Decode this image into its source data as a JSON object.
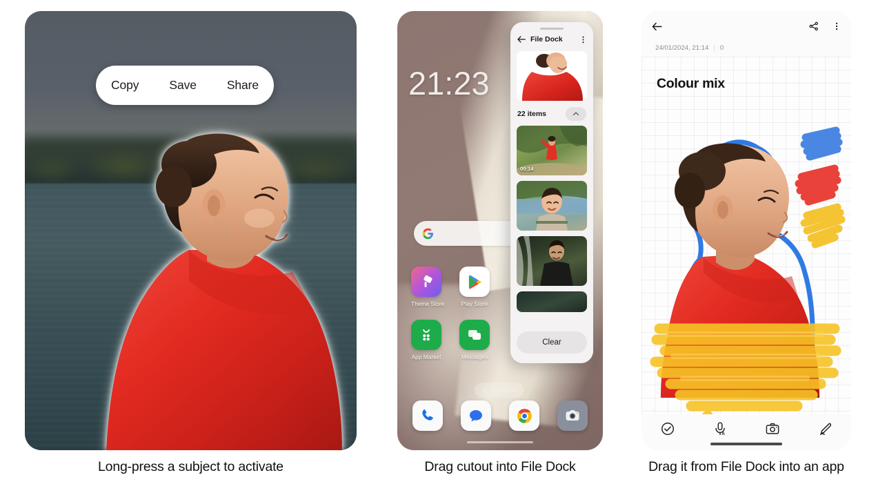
{
  "panels": [
    {
      "caption": "Long-press a subject to activate",
      "actions": [
        {
          "label": "Copy",
          "name": "copy-button"
        },
        {
          "label": "Save",
          "name": "save-button"
        },
        {
          "label": "Share",
          "name": "share-button"
        }
      ]
    },
    {
      "caption": "Drag cutout into File Dock"
    },
    {
      "caption": "Drag it from File Dock into an app"
    }
  ],
  "home": {
    "clock": "21:23",
    "search_widget_icon": "google-g-icon",
    "search_pill": {
      "label": "SEARCH",
      "icon": "search-icon"
    },
    "apps": [
      {
        "label": "Theme Store",
        "icon": "theme-store-icon"
      },
      {
        "label": "Play Store",
        "icon": "play-store-icon"
      },
      {
        "label": "App Market",
        "icon": "app-market-icon"
      },
      {
        "label": "Messages",
        "icon": "messages-icon"
      }
    ],
    "dock": [
      {
        "name": "phone-icon"
      },
      {
        "name": "messages-icon"
      },
      {
        "name": "chrome-icon"
      },
      {
        "name": "camera-icon"
      }
    ]
  },
  "file_dock": {
    "title": "File Dock",
    "back_icon": "back-arrow-icon",
    "menu_icon": "more-vertical-icon",
    "item_count": "22 items",
    "collapse_icon": "chevron-up-icon",
    "clear_label": "Clear",
    "thumbnails": [
      {
        "name": "video-thumbnail",
        "duration": "00:14"
      },
      {
        "name": "photo-thumbnail",
        "duration": ""
      },
      {
        "name": "photo-thumbnail",
        "duration": ""
      },
      {
        "name": "photo-thumbnail",
        "duration": ""
      }
    ]
  },
  "notes": {
    "back_icon": "back-arrow-icon",
    "share_icon": "share-icon",
    "menu_icon": "more-vertical-icon",
    "timestamp": "24/01/2024, 21:14",
    "separator": "|",
    "word_count": "0",
    "title": "Colour mix",
    "toolbar": [
      {
        "name": "checklist-icon"
      },
      {
        "name": "voice-input-icon"
      },
      {
        "name": "camera-icon"
      },
      {
        "name": "draw-pen-icon"
      }
    ]
  },
  "colors": {
    "highlight_blue": "#3b7de0",
    "highlight_red": "#e8342c",
    "highlight_yellow": "#f5c024",
    "sweater_red": "#e02b22",
    "wallpaper": "#8d7571"
  }
}
